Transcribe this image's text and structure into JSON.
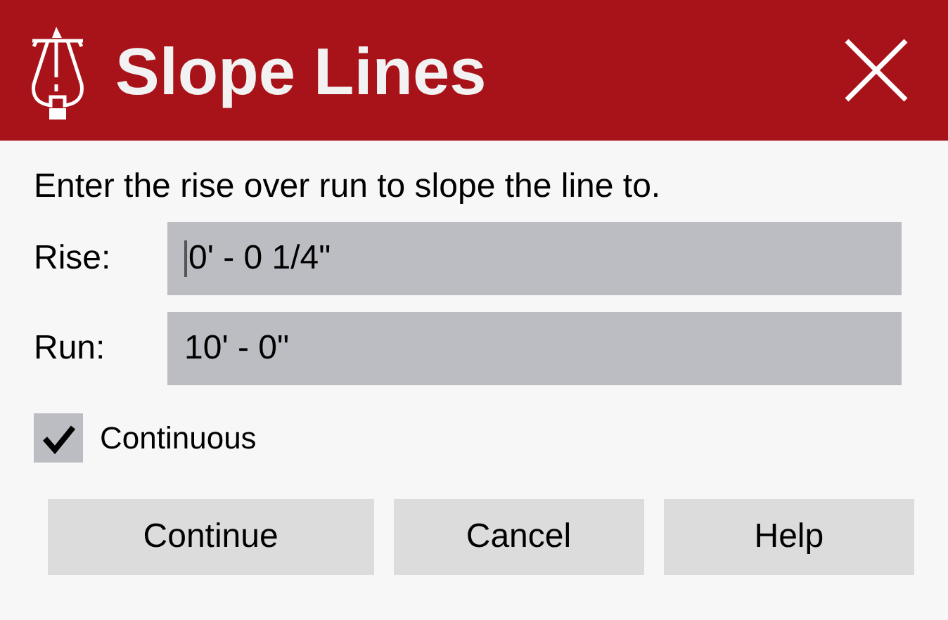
{
  "window": {
    "title": "Slope Lines"
  },
  "instruction": "Enter the rise over run to slope the line to.",
  "fields": [
    {
      "label": "Rise:",
      "value": "0' - 0 1/4\"",
      "focused": true
    },
    {
      "label": "Run:",
      "value": "10' - 0\"",
      "focused": false
    }
  ],
  "continuous": {
    "label": "Continuous",
    "checked": true
  },
  "buttons": [
    "Continue",
    "Cancel",
    "Help"
  ]
}
